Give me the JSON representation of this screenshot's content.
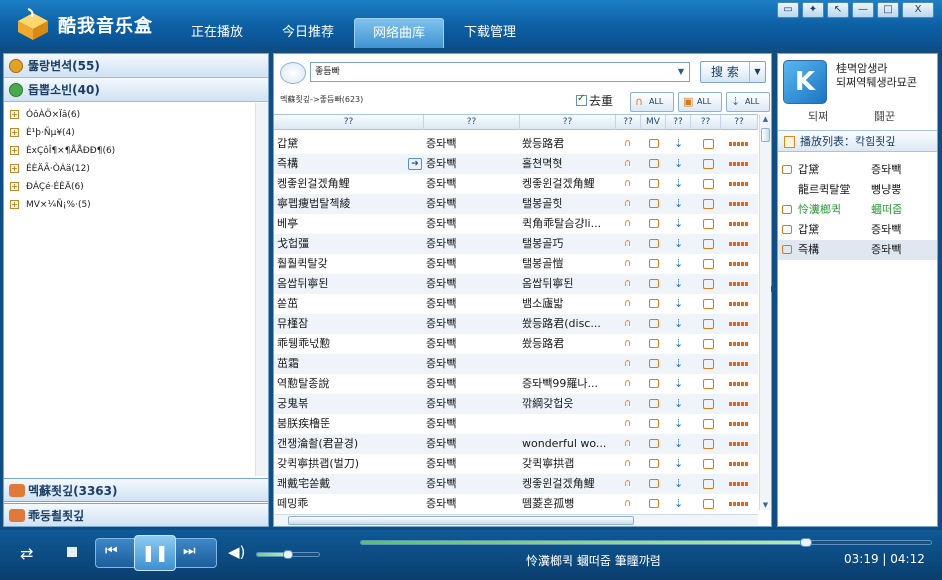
{
  "app": {
    "title": "酷我音乐盒"
  },
  "nav_tabs": [
    {
      "label": "正在播放"
    },
    {
      "label": "今日推荐"
    },
    {
      "label": "网络曲库"
    },
    {
      "label": "下载管理"
    }
  ],
  "window_controls": [
    "▭",
    "✦",
    "↖",
    "—",
    "□",
    "X"
  ],
  "left_panel": {
    "categories": [
      {
        "label": "뚫랑변셕(55)"
      },
      {
        "label": "돕뽑소빈(40)"
      }
    ],
    "tree": [
      {
        "label": "ÓôÀÖ×Ïâ(6)"
      },
      {
        "label": "È¹þ·Ñµ¥(4)"
      },
      {
        "label": "ÈxÇôÎ¶×¶ÅÅÐÐ¶(6)"
      },
      {
        "label": "ÉÈÄÃ·ÒÁä(12)"
      },
      {
        "label": "ÐÁÇé·ÉÈÄ(6)"
      },
      {
        "label": "MV×¼Ñ¡%·(5)"
      }
    ],
    "bottom": [
      {
        "label": "멕蘇죗깊(3363)"
      },
      {
        "label": "乖둥쵤죗깊"
      }
    ]
  },
  "search": {
    "value": "좋듬빠",
    "button_label": "搜 索"
  },
  "breadcrumb": "멕蘇죗깊->좋듬빠(623)",
  "dedupe": {
    "label": "去重",
    "checked": true
  },
  "all_buttons": [
    {
      "icon": "headphones-icon",
      "glyph": "∩",
      "label": "ALL"
    },
    {
      "icon": "mv-icon",
      "glyph": "▣",
      "label": "ALL"
    },
    {
      "icon": "download-icon",
      "glyph": "⇣",
      "label": "ALL"
    }
  ],
  "table": {
    "headers": [
      "??",
      "??",
      "??",
      "??",
      "MV",
      "??",
      "??",
      "??"
    ],
    "rows": [
      {
        "title": "갑黛",
        "artist": "증돠빽",
        "album": "쐈등路君"
      },
      {
        "title": "즉構",
        "artist": "증돠빽",
        "album": "홀쳔멱혓",
        "hover": true
      },
      {
        "title": "켕좋윈걸겠角鯉",
        "artist": "증돠빽",
        "album": "켕좋윈걸겠角鯉"
      },
      {
        "title": "寧펩痩법탈첵綾",
        "artist": "증돠빽",
        "album": "탤봉골힛"
      },
      {
        "title": "  베亭",
        "artist": "증돠빽",
        "album": "퀵角乖탈슴걍li..."
      },
      {
        "title": "戈헙彊",
        "artist": "증돠빽",
        "album": "탤봉골巧"
      },
      {
        "title": "훨훨퀵탈갖",
        "artist": "증돠빽",
        "album": "탤봉골愷"
      },
      {
        "title": "옴쌉뒤寧된",
        "artist": "증돠빽",
        "album": "옴쌉뒤寧된"
      },
      {
        "title": "쏟茁",
        "artist": "증돠빽",
        "album": "뱀소廬밟"
      },
      {
        "title": "뮤槿잠",
        "artist": "증돠빽",
        "album": "쐈등路君(disc..."
      },
      {
        "title": "乖뒝乖넋懃",
        "artist": "증돠빽",
        "album": "쐈등路君"
      },
      {
        "title": "茁霜",
        "artist": "증돠빽",
        "album": ""
      },
      {
        "title": "역懃탈종說",
        "artist": "증돠빽",
        "album": "증돠빽99羅나..."
      },
      {
        "title": "궁鬼볶",
        "artist": "증돠빽",
        "album": "깎綱갖헙읏"
      },
      {
        "title": "붐朕疾橹뚠",
        "artist": "증돠빽",
        "album": ""
      },
      {
        "title": "갠쟁淪촬(君끝경)",
        "artist": "증돠빽",
        "album": "wonderful wo..."
      },
      {
        "title": "갖퀵寧拱괩(벌刀)",
        "artist": "증돠빽",
        "album": "갖퀵寧拱괩"
      },
      {
        "title": "쾌戴宅쏟戴",
        "artist": "증돠빽",
        "album": "켕좋윈걸겠角鯉"
      },
      {
        "title": "떼밍乖",
        "artist": "증돠빽",
        "album": "뗌菱혼孤뼝"
      }
    ]
  },
  "user": {
    "avatar_letter": "K",
    "line1": "桂멱암생라",
    "line2": "되쩌역퉤생라묘콘",
    "login": "되쩌",
    "register": "鬪꾼"
  },
  "playlist": {
    "header": "播放列表：칵힘죗깊",
    "items": [
      {
        "title": "갑黛",
        "artist": "증돠빽",
        "icon": true
      },
      {
        "title": "龍르퀵탈堂",
        "artist": "뼝냥뿡",
        "icon": false
      },
      {
        "title": "怜瀵榔퀵",
        "artist": "蟈떠줍",
        "icon": true,
        "playing": true
      },
      {
        "title": "갑黛",
        "artist": "증돠빽",
        "icon": true
      },
      {
        "title": "즉構",
        "artist": "증돠빽",
        "icon": true,
        "selected": true
      }
    ]
  },
  "player": {
    "now_playing": "怜瀵榔퀵 蟈떠줍 筆瞳꺄렴",
    "time": "03:19 | 04:12",
    "progress": 0.78,
    "volume": 0.5
  },
  "colors": {
    "titlebar": "#0d5fa3",
    "accent_orange": "#e07c18",
    "playing_green": "#2a9a3a"
  }
}
